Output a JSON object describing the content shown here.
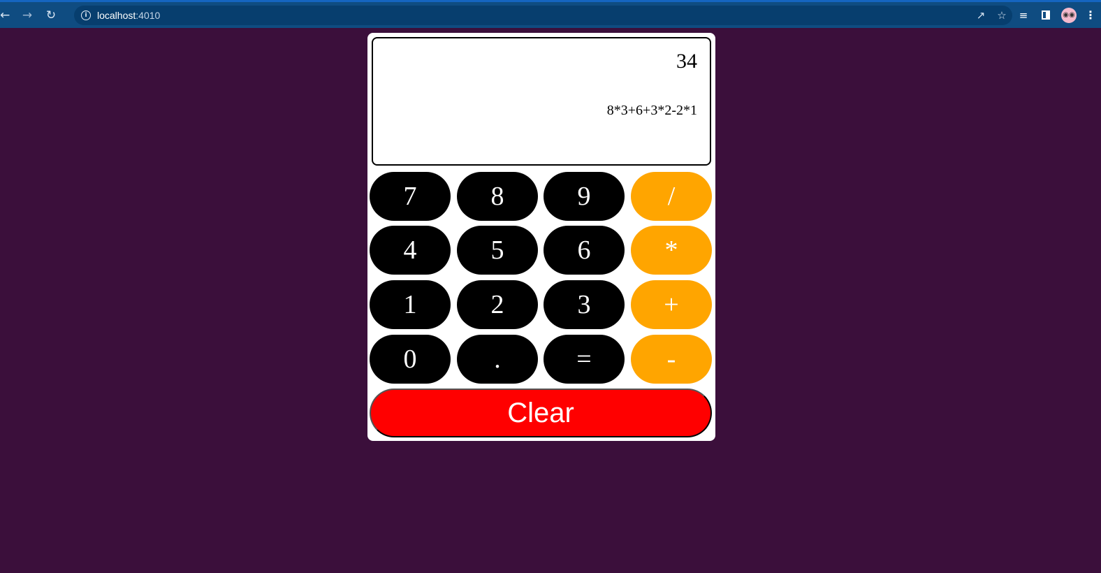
{
  "browser": {
    "url_host": "localhost",
    "url_port": ":4010",
    "icons": [
      "back-arrow-icon",
      "forward-arrow-icon",
      "reload-icon",
      "info-icon",
      "share-icon",
      "star-icon",
      "reading-list-icon",
      "side-panel-icon",
      "profile-avatar",
      "menu-icon"
    ]
  },
  "calculator": {
    "result": "34",
    "expression": "8*3+6+3*2-2*1",
    "keys": {
      "k7": "7",
      "k8": "8",
      "k9": "9",
      "div": "/",
      "k4": "4",
      "k5": "5",
      "k6": "6",
      "mul": "*",
      "k1": "1",
      "k2": "2",
      "k3": "3",
      "add": "+",
      "k0": "0",
      "dot": ".",
      "eq": "=",
      "sub": "-"
    },
    "clear_label": "Clear"
  },
  "colors": {
    "page_background": "#3b0f3b",
    "number_key": "#000000",
    "operator_key": "#ffa500",
    "clear_key": "#ff0000",
    "browser_toolbar": "#0f4c81"
  }
}
